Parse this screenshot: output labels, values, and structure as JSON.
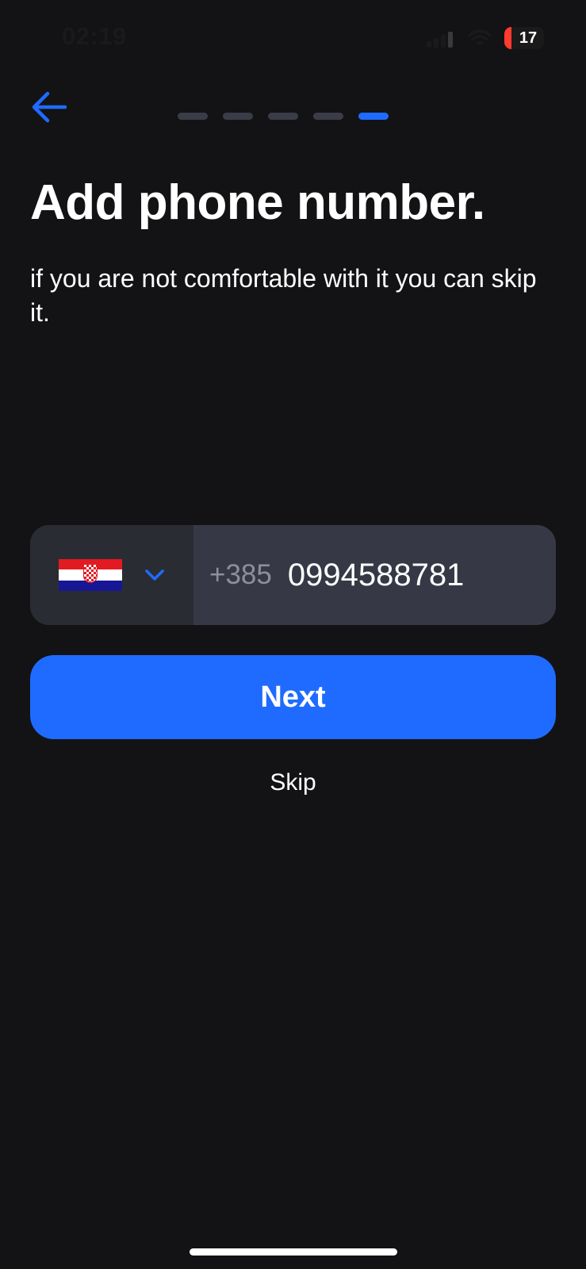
{
  "status_bar": {
    "time": "02:19",
    "battery_percent": "17",
    "battery_level": 0.17,
    "battery_color": "#ff3b30"
  },
  "header": {
    "back_icon": "arrow-left-icon",
    "progress": {
      "total_steps": 5,
      "current_step": 5
    }
  },
  "content": {
    "title": "Add phone number.",
    "subtitle": "if you are not comfortable with it you can skip it."
  },
  "phone": {
    "country_flag_icon": "croatia-flag-icon",
    "dropdown_icon": "chevron-down-icon",
    "dial_code": "+385",
    "number": "0994588781"
  },
  "actions": {
    "next_label": "Next",
    "skip_label": "Skip"
  },
  "colors": {
    "background": "#131315",
    "accent": "#1f6bff",
    "input_bg": "#363945",
    "select_bg": "#2a2c33",
    "progress_inactive": "#3a3d48",
    "muted_text": "#8d909a"
  }
}
